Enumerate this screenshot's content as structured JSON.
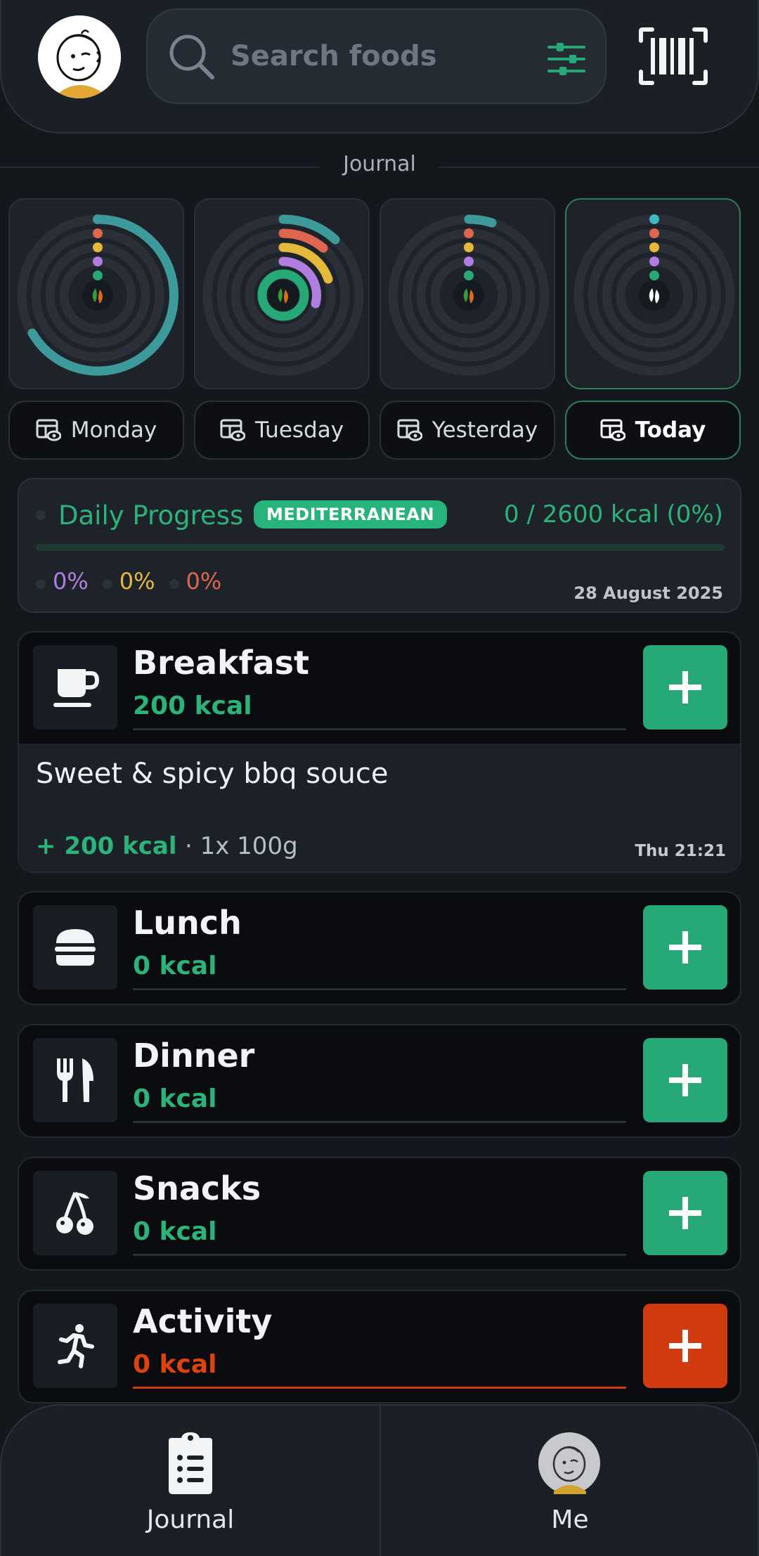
{
  "header": {
    "search_placeholder": "Search foods"
  },
  "journal_label": "Journal",
  "days": [
    {
      "label": "Monday"
    },
    {
      "label": "Tuesday"
    },
    {
      "label": "Yesterday"
    },
    {
      "label": "Today"
    }
  ],
  "progress": {
    "title": "Daily Progress",
    "badge": "MEDITERRANEAN",
    "kcal": "0 / 2600 kcal (0%)",
    "macro1": "0%",
    "macro2": "0%",
    "macro3": "0%",
    "date": "28 August 2025",
    "fraction": 0
  },
  "meals": {
    "breakfast": {
      "name": "Breakfast",
      "kcal": "200 kcal",
      "entry_name": "Sweet & spicy bbq souce",
      "entry_kcal": "+ 200 kcal",
      "entry_qty": "· 1x 100g",
      "entry_time": "Thu 21:21"
    },
    "lunch": {
      "name": "Lunch",
      "kcal": "0 kcal"
    },
    "dinner": {
      "name": "Dinner",
      "kcal": "0 kcal"
    },
    "snacks": {
      "name": "Snacks",
      "kcal": "0 kcal"
    },
    "activity": {
      "name": "Activity",
      "kcal": "0 kcal"
    }
  },
  "nav": {
    "journal": "Journal",
    "me": "Me"
  },
  "colors": {
    "accent_green": "#27a877",
    "activity_red": "#d23a10",
    "protein": "#b07ee0",
    "carbs": "#e5b93a",
    "fat": "#e0654f"
  }
}
